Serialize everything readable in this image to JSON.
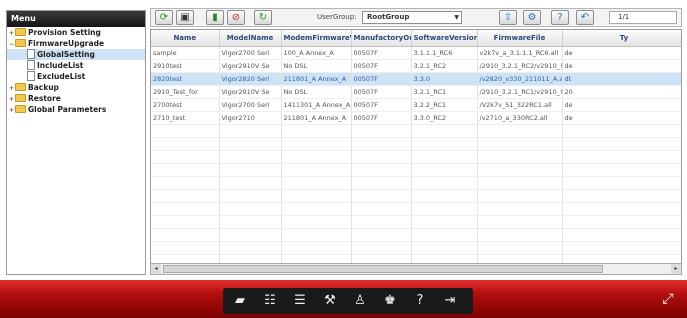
{
  "sidebar": {
    "title": "Menu",
    "items": [
      {
        "label": "Provision Setting",
        "expander": "+",
        "type": "folder",
        "indent": 0,
        "selected": false
      },
      {
        "label": "FirmwareUpgrade",
        "expander": "−",
        "type": "folder",
        "indent": 0,
        "selected": false
      },
      {
        "label": "GlobalSetting",
        "expander": "",
        "type": "doc",
        "indent": 1,
        "selected": true
      },
      {
        "label": "IncludeList",
        "expander": "",
        "type": "doc",
        "indent": 1,
        "selected": false
      },
      {
        "label": "ExcludeList",
        "expander": "",
        "type": "doc",
        "indent": 1,
        "selected": false
      },
      {
        "label": "Backup",
        "expander": "+",
        "type": "folder",
        "indent": 0,
        "selected": false
      },
      {
        "label": "Restore",
        "expander": "+",
        "type": "folder",
        "indent": 0,
        "selected": false
      },
      {
        "label": "Global Parameters",
        "expander": "+",
        "type": "folder",
        "indent": 0,
        "selected": false
      }
    ]
  },
  "toolbar": {
    "usergroup_label": "UserGroup:",
    "usergroup_value": "RootGroup",
    "page_indicator": "1/1",
    "icons": [
      "refresh-icon",
      "save-icon",
      "delete-icon",
      "stop-icon",
      "reload-icon",
      "upload-icon",
      "settings-icon",
      "help-icon",
      "back-icon"
    ]
  },
  "grid": {
    "columns": [
      "Name",
      "ModelName",
      "ModemFirmwareVersion",
      "ManufactoryOui",
      "SoftwareVersion",
      "FirmwareFile",
      "Ty"
    ],
    "rows": [
      {
        "cells": [
          "sample",
          "Vigor2700 Seri",
          "100_A Annex_A",
          "00507F",
          "3.1.1.1_RC6",
          "v2k7v_a_3.1.1.1_RC6.all",
          "de"
        ],
        "selected": false
      },
      {
        "cells": [
          "2910test",
          "Vigor2910V Se",
          "No DSL",
          "00507F",
          "3.2.1_RC2",
          "/2910_3.2.1_RC2/v2910_!",
          "de"
        ],
        "selected": false
      },
      {
        "cells": [
          "2820test",
          "Vigor2820 Seri",
          "211801_A Annex_A",
          "00507F",
          "3.3.0",
          "/v2820_v330_211011_A.a",
          "dt"
        ],
        "selected": true
      },
      {
        "cells": [
          "2910_Test_for",
          "Vigor2910V Se",
          "No DSL",
          "00507F",
          "3.2.1_RC1",
          "/2910_3.2.1_RC1/v2910_!",
          "20"
        ],
        "selected": false
      },
      {
        "cells": [
          "2700test",
          "Vigor2700 Seri",
          "1411301_A Annex_A",
          "00507F",
          "3.2.2_RC1",
          "/V2k7v_S1_322RC1.all",
          "de"
        ],
        "selected": false
      },
      {
        "cells": [
          "2710_test",
          "Vigor2710",
          "211801_A Annex_A",
          "00507F",
          "3.3.0_RC2",
          "/v2710_a_330RC2.all",
          "de"
        ],
        "selected": false
      }
    ],
    "empty_rows": 12
  },
  "bottombar": {
    "dock_icons": [
      "dashboard-icon",
      "calendar-icon",
      "list-icon",
      "tools-icon",
      "user-icon",
      "users-icon",
      "help-icon",
      "logout-icon"
    ],
    "dock_glyphs": [
      "▰",
      "☷",
      "☰",
      "⚒",
      "♙",
      "♚",
      "?",
      "⇥"
    ]
  }
}
